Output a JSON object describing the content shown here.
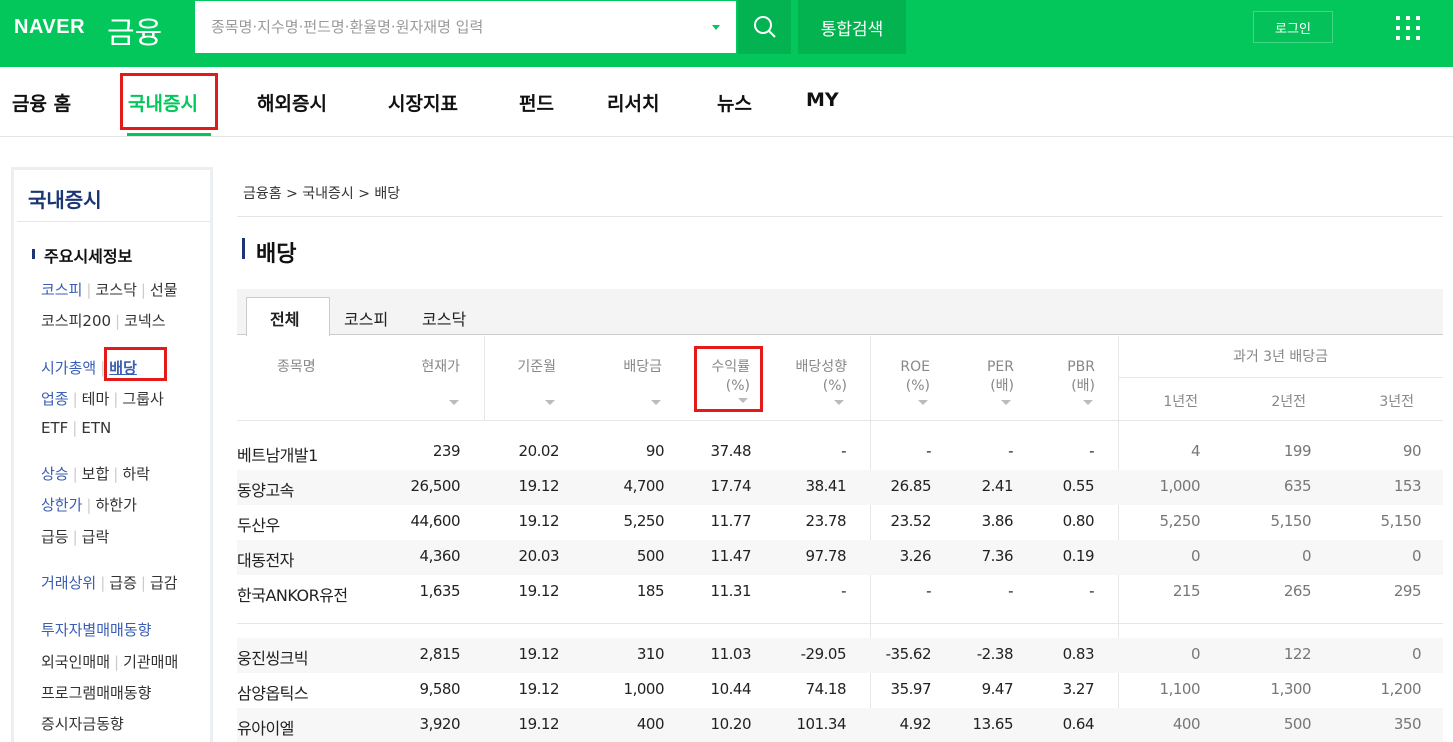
{
  "header": {
    "logo_naver": "NAVER",
    "logo_finance": "금융",
    "search_placeholder": "종목명·지수명·펀드명·환율명·원자재명 입력",
    "total_search_label": "통합검색",
    "login_label": "로그인",
    "brand_color": "#03c75a"
  },
  "nav": {
    "items": [
      "금융 홈",
      "국내증시",
      "해외증시",
      "시장지표",
      "펀드",
      "리서치",
      "뉴스",
      "MY"
    ],
    "active": "국내증시"
  },
  "sidebar": {
    "title": "국내증시",
    "section": "주요시세정보",
    "groups": [
      [
        "코스피",
        "코스닥",
        "선물"
      ],
      [
        "코스피200",
        "코넥스"
      ],
      [
        "시가총액",
        "배당"
      ],
      [
        "업종",
        "테마",
        "그룹사"
      ],
      [
        "ETF",
        "ETN"
      ],
      [
        "상승",
        "보합",
        "하락"
      ],
      [
        "상한가",
        "하한가"
      ],
      [
        "급등",
        "급락"
      ],
      [
        "거래상위",
        "급증",
        "급감"
      ],
      [
        "투자자별매매동향"
      ],
      [
        "외국인매매",
        "기관매매"
      ],
      [
        "프로그램매매동향"
      ],
      [
        "증시자금동향"
      ]
    ]
  },
  "breadcrumb": "금융홈 > 국내증시 > 배당",
  "page_title": "배당",
  "tabs": [
    "전체",
    "코스피",
    "코스닥"
  ],
  "table": {
    "headers": {
      "name": "종목명",
      "price": "현재가",
      "base_month": "기준월",
      "dividend": "배당금",
      "yield_1": "수익률",
      "yield_2": "(%)",
      "payout_1": "배당성향",
      "payout_2": "(%)",
      "roe_1": "ROE",
      "roe_2": "(%)",
      "per_1": "PER",
      "per_2": "(배)",
      "pbr_1": "PBR",
      "pbr_2": "(배)",
      "hist": "과거 3년 배당금",
      "y1": "1년전",
      "y2": "2년전",
      "y3": "3년전"
    },
    "rows": [
      {
        "name": "베트남개발1",
        "price": "239",
        "month": "20.02",
        "div": "90",
        "yield": "37.48",
        "payout": "-",
        "roe": "-",
        "per": "-",
        "pbr": "-",
        "y1": "4",
        "y2": "199",
        "y3": "90"
      },
      {
        "name": "동양고속",
        "price": "26,500",
        "month": "19.12",
        "div": "4,700",
        "yield": "17.74",
        "payout": "38.41",
        "roe": "26.85",
        "per": "2.41",
        "pbr": "0.55",
        "y1": "1,000",
        "y2": "635",
        "y3": "153"
      },
      {
        "name": "두산우",
        "price": "44,600",
        "month": "19.12",
        "div": "5,250",
        "yield": "11.77",
        "payout": "23.78",
        "roe": "23.52",
        "per": "3.86",
        "pbr": "0.80",
        "y1": "5,250",
        "y2": "5,150",
        "y3": "5,150"
      },
      {
        "name": "대동전자",
        "price": "4,360",
        "month": "20.03",
        "div": "500",
        "yield": "11.47",
        "payout": "97.78",
        "roe": "3.26",
        "per": "7.36",
        "pbr": "0.19",
        "y1": "0",
        "y2": "0",
        "y3": "0"
      },
      {
        "name": "한국ANKOR유전",
        "price": "1,635",
        "month": "19.12",
        "div": "185",
        "yield": "11.31",
        "payout": "-",
        "roe": "-",
        "per": "-",
        "pbr": "-",
        "y1": "215",
        "y2": "265",
        "y3": "295"
      },
      {
        "name": "웅진씽크빅",
        "price": "2,815",
        "month": "19.12",
        "div": "310",
        "yield": "11.03",
        "payout": "-29.05",
        "roe": "-35.62",
        "per": "-2.38",
        "pbr": "0.83",
        "y1": "0",
        "y2": "122",
        "y3": "0"
      },
      {
        "name": "삼양옵틱스",
        "price": "9,580",
        "month": "19.12",
        "div": "1,000",
        "yield": "10.44",
        "payout": "74.18",
        "roe": "35.97",
        "per": "9.47",
        "pbr": "3.27",
        "y1": "1,100",
        "y2": "1,300",
        "y3": "1,200"
      },
      {
        "name": "유아이엘",
        "price": "3,920",
        "month": "19.12",
        "div": "400",
        "yield": "10.20",
        "payout": "101.34",
        "roe": "4.92",
        "per": "13.65",
        "pbr": "0.64",
        "y1": "400",
        "y2": "500",
        "y3": "350"
      }
    ]
  }
}
